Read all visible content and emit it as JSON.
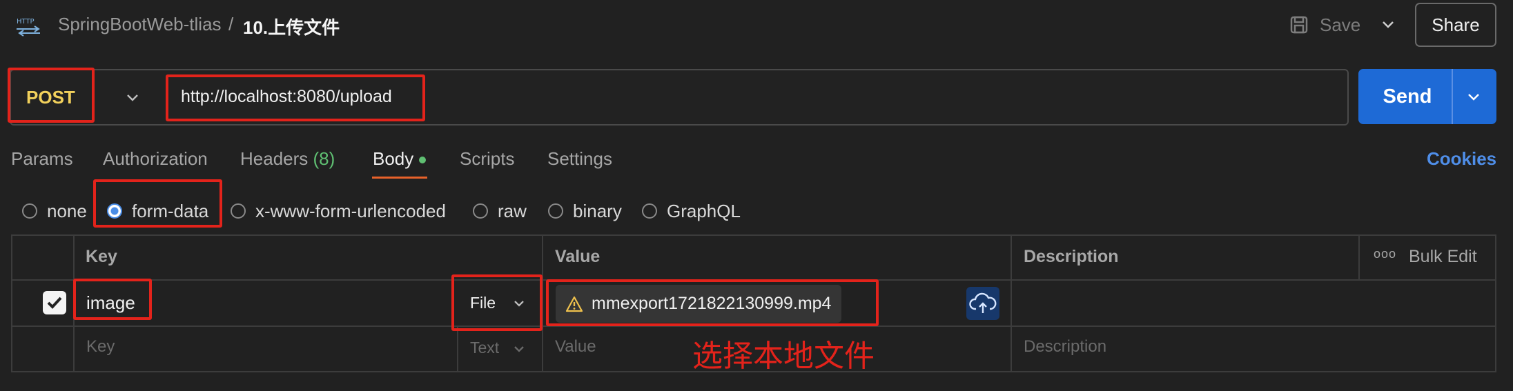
{
  "header": {
    "collection": "SpringBootWeb-tlias",
    "separator": "/",
    "request_name": "10.上传文件",
    "save_label": "Save",
    "share_label": "Share"
  },
  "request": {
    "method": "POST",
    "url": "http://localhost:8080/upload",
    "send_label": "Send"
  },
  "tabs": {
    "params": "Params",
    "authorization": "Authorization",
    "headers": "Headers",
    "headers_count": "(8)",
    "body": "Body",
    "scripts": "Scripts",
    "settings": "Settings",
    "cookies": "Cookies"
  },
  "body_types": {
    "none": "none",
    "form_data": "form-data",
    "urlencoded": "x-www-form-urlencoded",
    "raw": "raw",
    "binary": "binary",
    "graphql": "GraphQL",
    "selected": "form-data"
  },
  "table": {
    "headers": {
      "key": "Key",
      "value": "Value",
      "description": "Description",
      "bulk_edit": "Bulk Edit",
      "more": "ooo"
    },
    "rows": [
      {
        "checked": true,
        "key": "image",
        "type": "File",
        "value": "mmexport1721822130999.mp4",
        "description": ""
      }
    ],
    "placeholder": {
      "key": "Key",
      "type": "Text",
      "value": "Value",
      "description": "Description"
    }
  },
  "annotation": "选择本地文件",
  "colors": {
    "background": "#212121",
    "method": "#f2d15c",
    "send": "#1e6ad6",
    "cookies": "#4f8ee8",
    "highlight": "#e3231b",
    "active_tab_underline": "#e8622a",
    "status_dot": "#5fbf72"
  }
}
